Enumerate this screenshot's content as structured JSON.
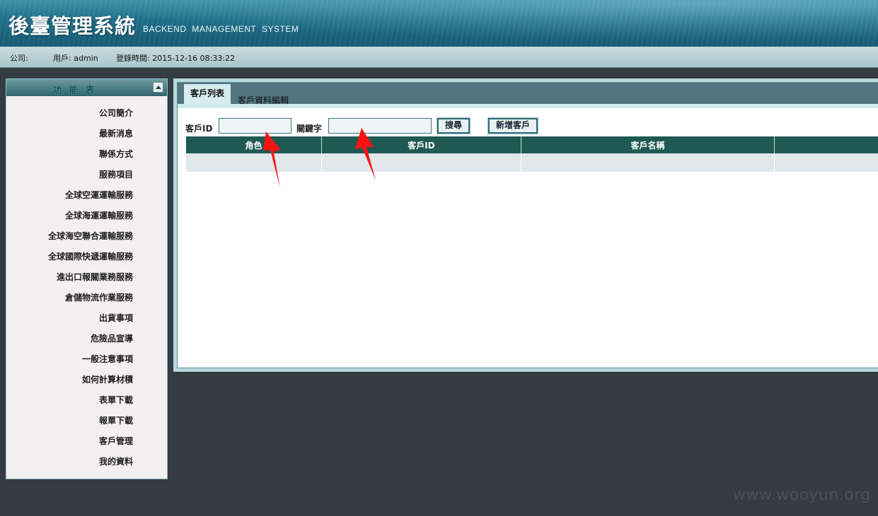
{
  "header": {
    "title_cn": "後臺管理系統",
    "title_en": "BACKEND  MANAGEMENT  SYSTEM"
  },
  "infobar": {
    "company_label": "公司:",
    "user_label": "用戶: admin",
    "login_time": "登錄時間: 2015-12-16 08:33:22"
  },
  "sidebar": {
    "title": "功能表",
    "items": [
      {
        "label": "公司簡介"
      },
      {
        "label": "最新消息"
      },
      {
        "label": "聯係方式"
      },
      {
        "label": "服務項目"
      },
      {
        "label": "全球空運運輸服務"
      },
      {
        "label": "全球海運運輸服務"
      },
      {
        "label": "全球海空聯合運輸服務"
      },
      {
        "label": "全球國際快遞運輸服務"
      },
      {
        "label": "進出口報關業務服務"
      },
      {
        "label": "倉儲物流作業服務"
      },
      {
        "label": "出貨事項"
      },
      {
        "label": "危險品宣導"
      },
      {
        "label": "一般注意事項"
      },
      {
        "label": "如何計算材積"
      },
      {
        "label": "表單下載"
      },
      {
        "label": "報單下載"
      },
      {
        "label": "客戶管理"
      },
      {
        "label": "我的資料"
      }
    ]
  },
  "main": {
    "tabs": [
      {
        "label": "客戶列表",
        "active": true
      },
      {
        "label": "客戶資料編輯",
        "active": false
      }
    ],
    "search": {
      "customer_id_label": "客戶ID",
      "customer_id_value": "",
      "keyword_label": "關鍵字",
      "keyword_value": "",
      "search_button": "搜尋",
      "add_button": "新增客戶"
    },
    "table": {
      "columns": [
        "角色",
        "客戶ID",
        "客戶名稱",
        ""
      ],
      "rows": [
        [
          "",
          "",
          "",
          ""
        ]
      ]
    }
  },
  "watermark": "www.wooyun.org",
  "colors": {
    "header_bg": "#1f6d87",
    "table_header": "#1e5a52",
    "page_bg": "#353b42",
    "annotation_arrow": "#ff0000"
  }
}
